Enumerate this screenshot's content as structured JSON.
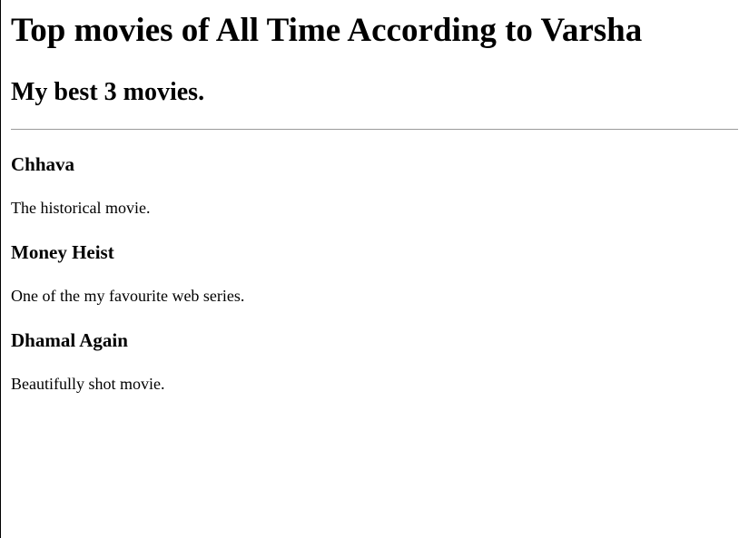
{
  "page": {
    "title": "Top movies of All Time According to Varsha",
    "subtitle": "My best 3 movies."
  },
  "movies": [
    {
      "title": "Chhava",
      "description": "The historical movie."
    },
    {
      "title": "Money Heist",
      "description": "One of the my favourite web series."
    },
    {
      "title": "Dhamal Again",
      "description": "Beautifully shot movie."
    }
  ]
}
